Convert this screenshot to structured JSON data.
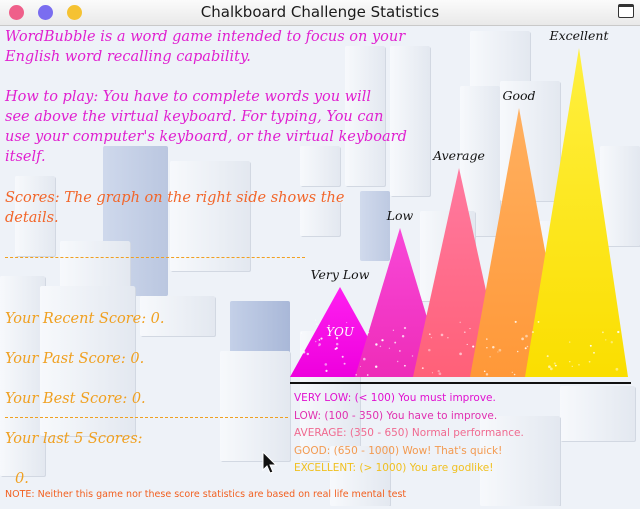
{
  "window": {
    "title": "Chalkboard Challenge Statistics"
  },
  "intro": {
    "text": "WordBubble is a word game intended to focus on your\nEnglish word recalling capability.\n\nHow to play: You have to complete words you will\nsee above the virtual keyboard. For typing, You can\nuse your computer's keyboard, or the virtual keyboard\nitself."
  },
  "scores_info": {
    "text": "Scores: The graph on the right side shows the\ndetails."
  },
  "scores": {
    "recent": "Your Recent Score: 0.",
    "past": "Your Past Score: 0.",
    "best": "Your Best Score: 0.",
    "last5_label": "Your last 5 Scores:",
    "last5_values": "0."
  },
  "chart_data": {
    "type": "bar",
    "categories": [
      "Very Low",
      "Low",
      "Average",
      "Good",
      "Excellent"
    ],
    "marker": "YOU",
    "marker_level": "Very Low",
    "colors": [
      "#ff10e6",
      "#f030c0",
      "#ff6c88",
      "#ffa043",
      "#fce310"
    ]
  },
  "legend": [
    {
      "text": "VERY LOW: (< 100) You must improve.",
      "color": "#e010d0"
    },
    {
      "text": "LOW: (100 - 350) You have to improve.",
      "color": "#e030b0"
    },
    {
      "text": "AVERAGE: (350 - 650) Normal performance.",
      "color": "#f06a90"
    },
    {
      "text": "GOOD: (650 - 1000) Wow! That's quick!",
      "color": "#f39a50"
    },
    {
      "text": "EXCELLENT: (> 1000) You are godlike!",
      "color": "#f0c020"
    }
  ],
  "note": "NOTE: Neither this game nor these score statistics are based on real life mental test"
}
